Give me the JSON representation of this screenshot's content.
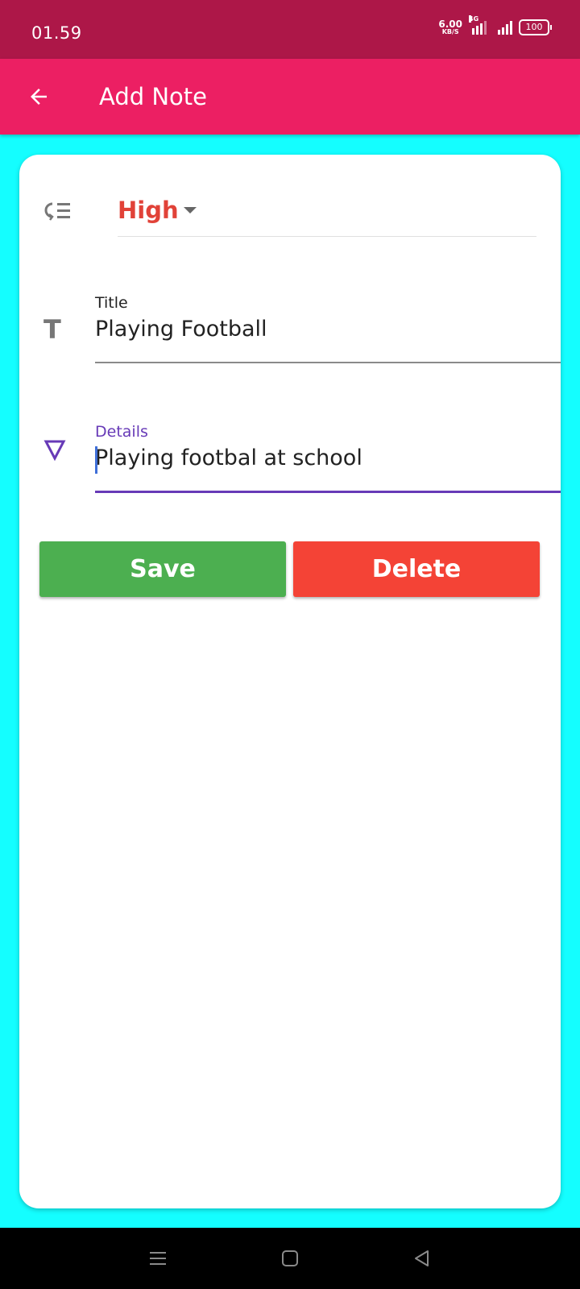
{
  "status_bar": {
    "time": "01.59",
    "net_speed_value": "6.00",
    "net_speed_unit": "KB/S",
    "network_type": "4G",
    "battery": "100"
  },
  "app_bar": {
    "title": "Add Note",
    "back_icon": "arrow-left-icon"
  },
  "form": {
    "priority": {
      "icon": "priority-list-icon",
      "selected": "High",
      "color": "#E14238"
    },
    "title_field": {
      "label": "Title",
      "value": "Playing Football",
      "icon": "text-t-icon"
    },
    "details_field": {
      "label": "Details",
      "value": "Playing footbal at school",
      "icon": "triangle-down-icon"
    }
  },
  "buttons": {
    "save_label": "Save",
    "delete_label": "Delete"
  },
  "colors": {
    "status_bar": "#AD1748",
    "app_bar": "#EC1F63",
    "background": "#14FEFF",
    "accent": "#673AB7",
    "save": "#4CAF50",
    "delete": "#F44336"
  },
  "nav": {
    "menu_icon": "menu-icon",
    "home_icon": "square-home-icon",
    "back_icon": "triangle-back-icon"
  }
}
